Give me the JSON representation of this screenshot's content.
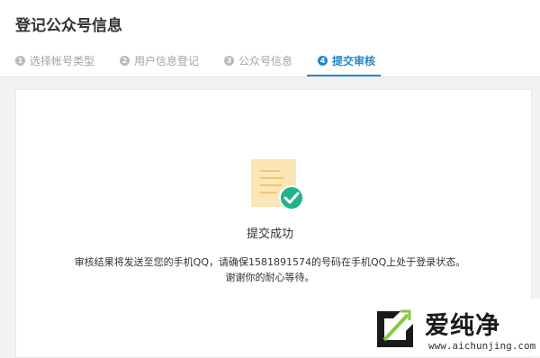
{
  "page": {
    "title": "登记公众号信息"
  },
  "steps": [
    {
      "number": "1",
      "label": "选择帐号类型"
    },
    {
      "number": "2",
      "label": "用户信息登记"
    },
    {
      "number": "3",
      "label": "公众号信息"
    },
    {
      "number": "4",
      "label": "提交审核"
    }
  ],
  "active_step": 4,
  "result": {
    "title": "提交成功",
    "message_line1": "审核结果将发送至您的手机QQ，请确保1581891574的号码在手机QQ上处于登录状态。",
    "message_line2": "谢谢你的耐心等待。"
  },
  "watermark": {
    "brand": "爱纯净",
    "url": "www.aichunjing.com"
  },
  "colors": {
    "accent": "#2587c6",
    "success": "#1fb38a",
    "document": "#fbe6b6"
  }
}
